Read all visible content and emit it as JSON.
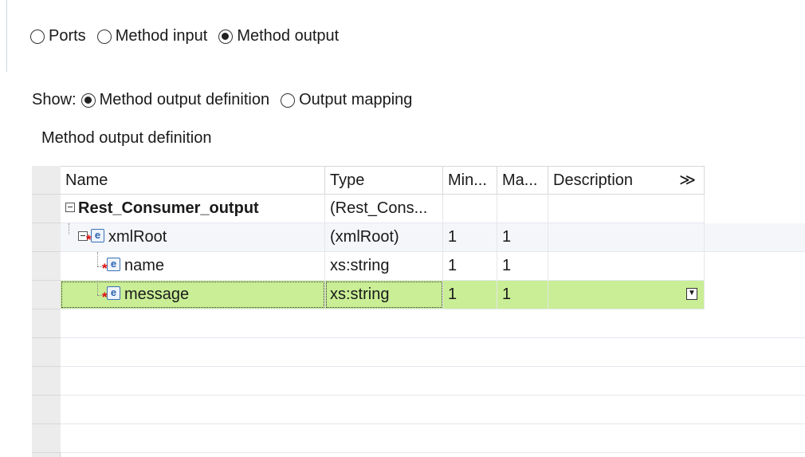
{
  "view_mode": {
    "options": [
      {
        "label": "Ports",
        "checked": false
      },
      {
        "label": "Method input",
        "checked": false
      },
      {
        "label": "Method output",
        "checked": true
      }
    ]
  },
  "show": {
    "label": "Show:",
    "options": [
      {
        "label": "Method output definition",
        "checked": true
      },
      {
        "label": "Output mapping",
        "checked": false
      }
    ]
  },
  "section_title": "Method output definition",
  "table": {
    "headers": [
      "Name",
      "Type",
      "Min...",
      "Ma...",
      "Description",
      "≫"
    ],
    "rows": [
      {
        "name": "Rest_Consumer_output",
        "type": "(Rest_Cons...",
        "min": "",
        "max": "",
        "description": "",
        "expander": true,
        "icon": false,
        "bold": true
      },
      {
        "name": "xmlRoot",
        "type": "(xmlRoot)",
        "min": "1",
        "max": "1",
        "description": "",
        "expander": true,
        "icon": "element-icon"
      },
      {
        "name": "name",
        "type": "xs:string",
        "min": "1",
        "max": "1",
        "description": "",
        "icon": "element-icon"
      },
      {
        "name": "message",
        "type": "xs:string",
        "min": "1",
        "max": "1",
        "description": "",
        "icon": "element-icon",
        "selected": true
      }
    ],
    "icon_letter": "e",
    "required_marker": "*",
    "selected_color": "#c9ee96"
  }
}
